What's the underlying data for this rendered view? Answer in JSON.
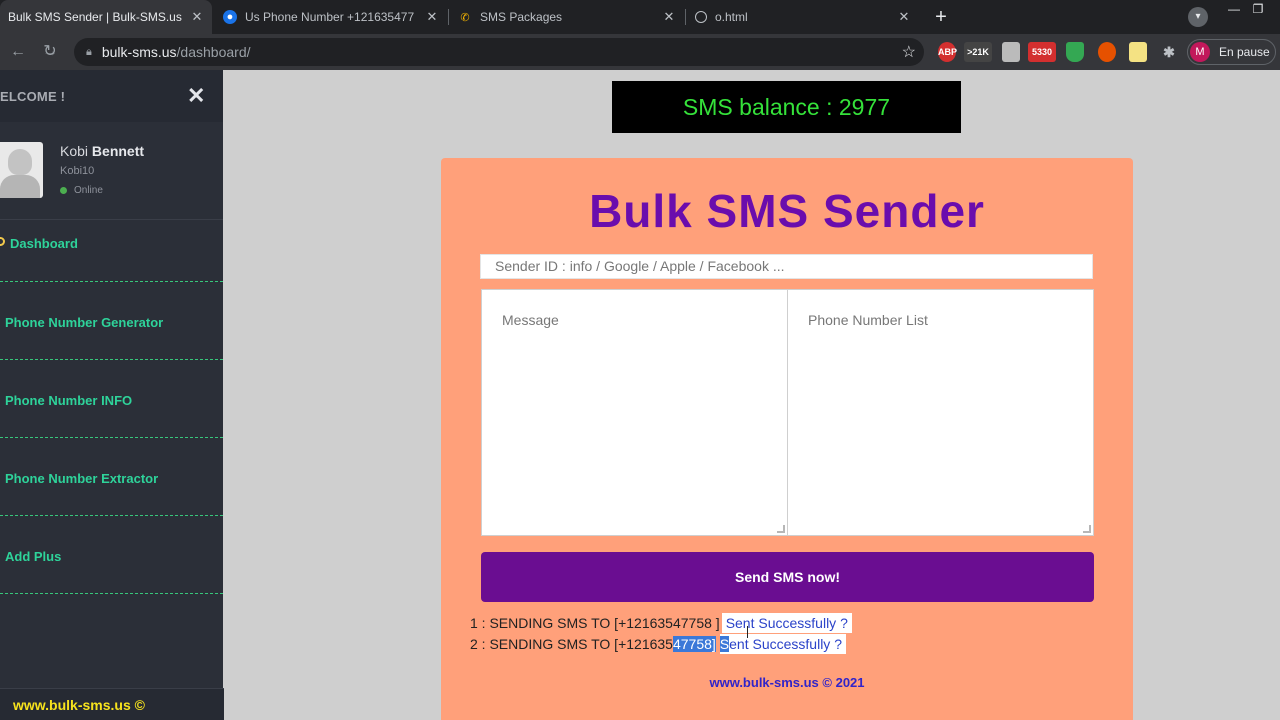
{
  "browser": {
    "tabs": [
      {
        "label": "Bulk SMS Sender | Bulk-SMS.us",
        "icon": "bulk-sms-favicon",
        "active": true
      },
      {
        "label": "Us Phone Number +121635477",
        "icon": "chat-favicon",
        "active": false
      },
      {
        "label": "SMS Packages",
        "icon": "phone-favicon",
        "active": false
      },
      {
        "label": "o.html",
        "icon": "globe-favicon",
        "active": false
      }
    ],
    "url_host": "bulk-sms.us",
    "url_path": "/dashboard/",
    "extensions": [
      "ABP",
      ">21K",
      "",
      "5330",
      "",
      "",
      "",
      ""
    ],
    "profile_initial": "M",
    "profile_status": "En pause"
  },
  "sidebar": {
    "welcome": "ELCOME !",
    "user_first": "Kobi",
    "user_last": "Bennett",
    "username": "Kobi10",
    "status": "Online",
    "items": [
      {
        "label": "Dashboard"
      },
      {
        "label": "Phone Number Generator"
      },
      {
        "label": "Phone Number INFO"
      },
      {
        "label": "Phone Number Extractor"
      },
      {
        "label": "Add Plus"
      }
    ],
    "footer": "www.bulk-sms.us ©"
  },
  "main": {
    "balance_label": "SMS balance : 2977",
    "title": "Bulk SMS Sender",
    "sender_placeholder": "Sender ID : info / Google / Apple / Facebook ...",
    "message_placeholder": "Message",
    "phone_placeholder": "Phone Number List",
    "send_button": "Send SMS now!",
    "log": [
      {
        "prefix": "1 : SENDING SMS TO [+12163547758 ]",
        "result": "Sent Successfully ?"
      },
      {
        "prefix_a": "2 : SENDING SMS TO [+121635",
        "prefix_b": "47758]",
        "result_a": "S",
        "result_b": "ent Successfully ?"
      }
    ],
    "footer": "www.bulk-sms.us © 2021"
  },
  "colors": {
    "accent_purple": "#6a0d91",
    "card_bg": "#ffa07a",
    "balance_text": "#35e23a",
    "sidebar_link": "#2ed39a"
  }
}
